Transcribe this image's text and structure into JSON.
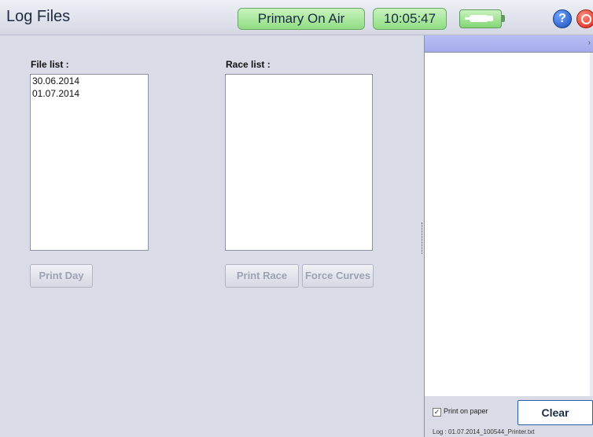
{
  "header": {
    "title": "Log Files",
    "status": "Primary On Air",
    "clock": "10:05:47",
    "battery_icon": "battery-plugged-icon",
    "help_label": "?",
    "help_icon": "help-icon",
    "power_icon": "power-icon"
  },
  "file_panel": {
    "label": "File list :",
    "items": [
      "30.06.2014",
      "01.07.2014"
    ],
    "print_button": "Print Day"
  },
  "race_panel": {
    "label": "Race list :",
    "items": [],
    "print_button": "Print Race",
    "force_curves_button": "Force Curves"
  },
  "printer_panel": {
    "chevron": "›",
    "print_on_paper_label": "Print on paper",
    "print_on_paper_checked": true,
    "clear_button": "Clear",
    "log_file": "Log : 01.07.2014_100544_Printer.txt"
  },
  "colors": {
    "accent_green": "#8fdc83",
    "panel_header": "#a5abea",
    "background": "#d9dbe6"
  }
}
